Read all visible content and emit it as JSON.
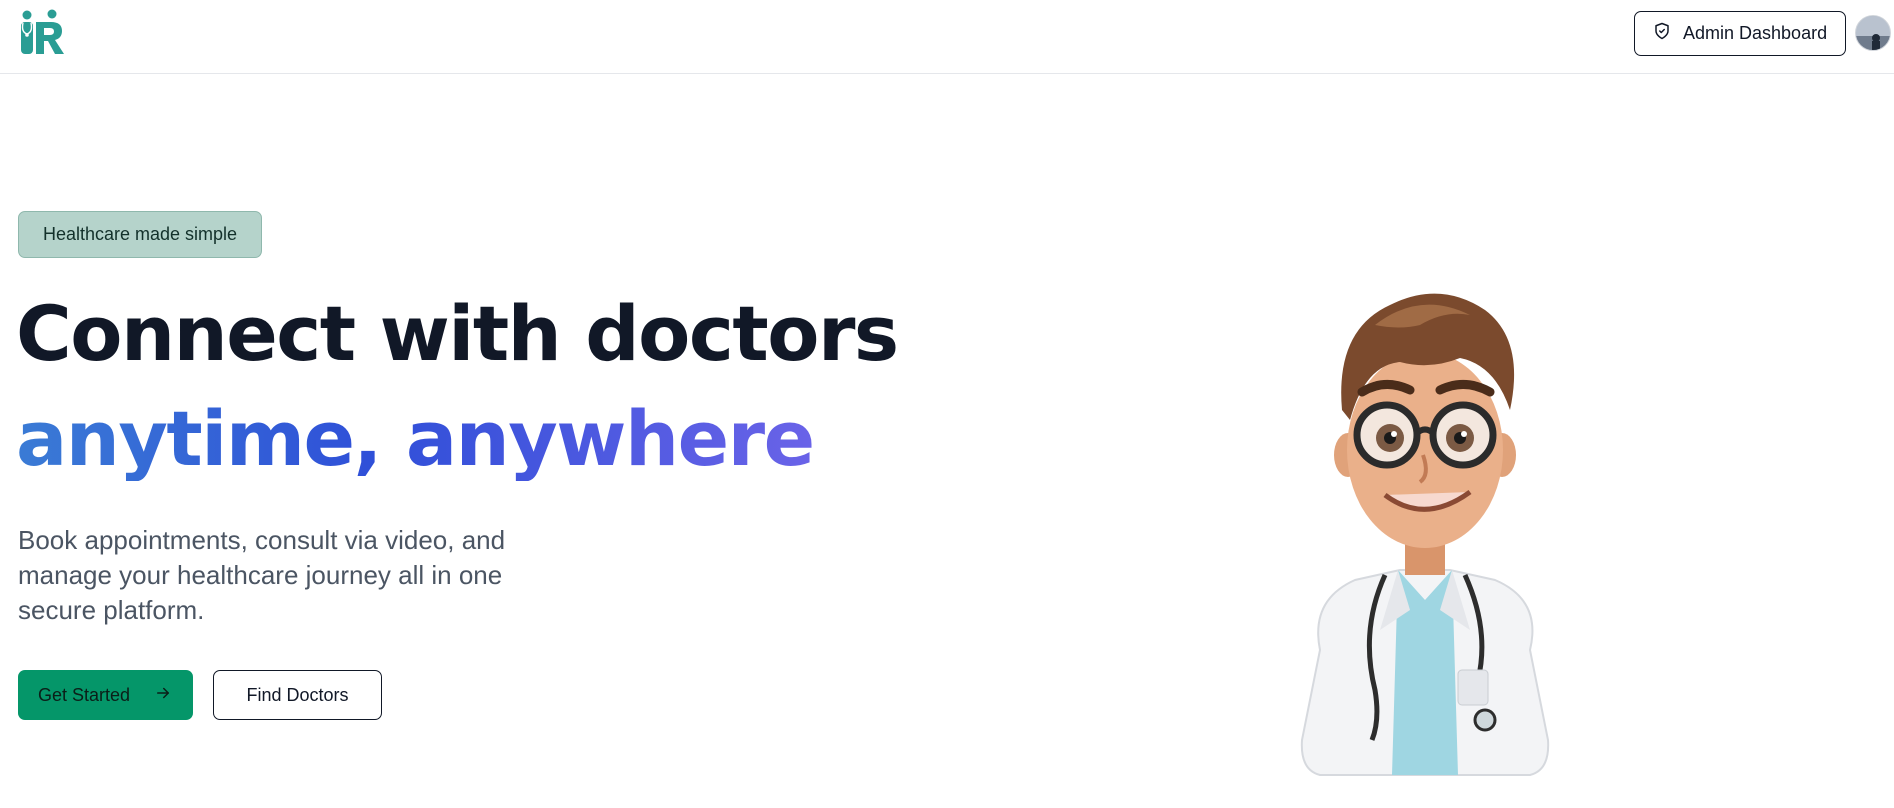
{
  "header": {
    "admin_label": "Admin Dashboard",
    "admin_icon": "shield-icon",
    "logo_icon": "doctor-logo-icon"
  },
  "hero": {
    "badge": "Healthcare made simple",
    "headline_line1": "Connect with doctors",
    "headline_line2": "anytime, anywhere",
    "subtext": "Book appointments, consult via video, and manage your healthcare journey all in one secure platform.",
    "primary_cta": "Get Started",
    "primary_cta_icon": "arrow-right-icon",
    "secondary_cta": "Find Doctors"
  },
  "colors": {
    "brand_teal": "#2a9d94",
    "primary_green": "#059669",
    "badge_bg": "#b5d3cb",
    "gradient_start": "#3a7bd5",
    "gradient_end": "#6a63e8"
  }
}
